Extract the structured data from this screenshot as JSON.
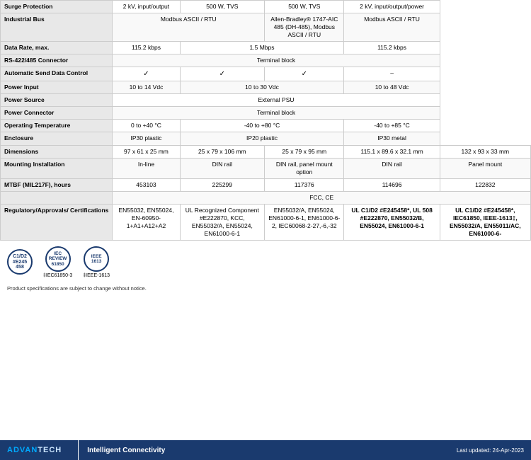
{
  "table": {
    "rows": [
      {
        "label": "Surge Protection",
        "cols": [
          "2 kV, input/output",
          "500 W, TVS",
          "500 W, TVS",
          "2 kV, input/output/power"
        ]
      },
      {
        "label": "Industrial Bus",
        "cols": [
          "Modbus ASCII / RTU",
          "",
          "Allen-Bradley® 1747-AIC 485 (DH-485), Modbus ASCII / RTU",
          "Modbus ASCII / RTU"
        ]
      },
      {
        "label": "Data Rate, max.",
        "cols": [
          "115.2 kbps",
          "1.5 Mbps",
          "",
          "115.2 kbps"
        ]
      },
      {
        "label": "RS-422/485 Connector",
        "cols": [
          "",
          "Terminal block",
          "",
          ""
        ]
      },
      {
        "label": "Automatic Send Data Control",
        "cols": [
          "✓",
          "✓",
          "✓",
          "–"
        ]
      },
      {
        "label": "Power Input",
        "cols": [
          "10 to 14  Vdc",
          "10 to 30 Vdc",
          "",
          "10 to 48 Vdc"
        ]
      },
      {
        "label": "Power Source",
        "cols": [
          "",
          "External PSU",
          "",
          ""
        ]
      },
      {
        "label": "Power Connector",
        "cols": [
          "",
          "Terminal block",
          "",
          ""
        ]
      },
      {
        "label": "Operating Temperature",
        "cols": [
          "0 to +40 °C",
          "-40 to +80 °C",
          "",
          "-40 to +85 °C"
        ]
      },
      {
        "label": "Enclosure",
        "cols": [
          "IP30 plastic",
          "IP20 plastic",
          "",
          "IP30 metal"
        ]
      },
      {
        "label": "Dimensions",
        "cols": [
          "97 x 61 x 25 mm",
          "25 x 79 x 106 mm",
          "25 x 79 x 95 mm",
          "115.1 x 89.6 x 32.1 mm",
          "132 x 93 x 33 mm"
        ]
      },
      {
        "label": "Mounting Installation",
        "cols": [
          "In-line",
          "DIN rail",
          "DIN rail, panel mount option",
          "DIN rail",
          "Panel mount"
        ]
      },
      {
        "label": "MTBF (MIL217F), hours",
        "cols": [
          "453103",
          "225299",
          "117376",
          "114696",
          "122832"
        ]
      },
      {
        "label": "Regulatory/Approvals/ Certifications",
        "cols": [
          "EN55032, EN55024, EN-60950-1+A1+A12+A2",
          "UL Recognized Component #E222870, KCC, EN55032/A, EN55024, EN61000-6-1",
          "EN55032/A, EN55024, EN61000-6-1, EN61000-6-2, IEC60068-2-27,-6,-32",
          "UL C1/D2 #E245458*, UL 508 #E222870, EN55032/B, EN55024, EN61000-6-1",
          "UL C1/D2 #E245458*, IEC61850, IEEE-1613‡, EN55032/A, EN55011/AC, EN61000-6-"
        ]
      }
    ],
    "cert_standards": [
      "FCC, CE"
    ],
    "cert_badges": [
      {
        "id": "c1d2",
        "line1": "C1/D2",
        "line2": "#E245458"
      },
      {
        "id": "iec61850",
        "line1": "IEC",
        "line2": "61850-3",
        "label": "‡IEC61850-3"
      },
      {
        "id": "ieee1613",
        "line1": "IEEE",
        "line2": "1613",
        "label": "‡IEEE-1613"
      }
    ]
  },
  "footer": {
    "logo_text": "ADVANTECH",
    "tagline": "Intelligent Connectivity",
    "update": "Last updated: 24-Apr-2023",
    "disclaimer": "Product specifications are subject to change without notice."
  }
}
